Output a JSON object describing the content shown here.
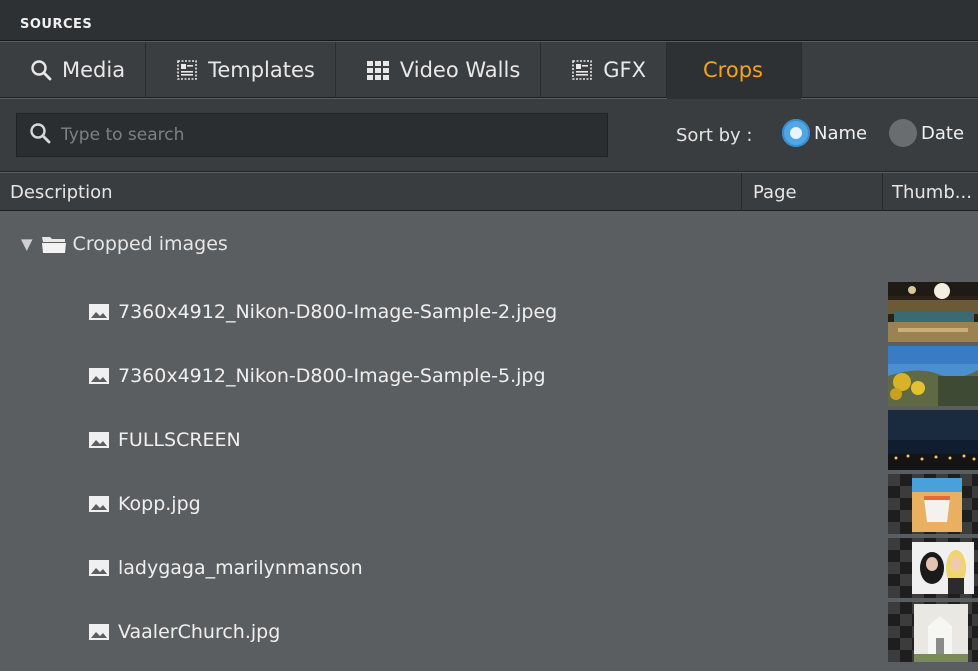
{
  "panel": {
    "title": "SOURCES"
  },
  "tabs": [
    {
      "label": "Media",
      "icon": "search-icon",
      "active": false
    },
    {
      "label": "Templates",
      "icon": "template-icon",
      "active": false
    },
    {
      "label": "Video Walls",
      "icon": "video-wall-icon",
      "active": false
    },
    {
      "label": "GFX",
      "icon": "template-icon",
      "active": false
    },
    {
      "label": "Crops",
      "icon": "",
      "active": true
    }
  ],
  "search": {
    "placeholder": "Type to search",
    "value": ""
  },
  "sort": {
    "label": "Sort by :",
    "options": [
      {
        "label": "Name",
        "selected": true
      },
      {
        "label": "Date",
        "selected": false
      }
    ]
  },
  "columns": {
    "description": "Description",
    "page": "Page",
    "thumbnail": "Thumb..."
  },
  "tree": {
    "folder": {
      "label": "Cropped images",
      "expanded": true,
      "icon": "folder-open-icon"
    },
    "items": [
      {
        "label": "7360x4912_Nikon-D800-Image-Sample-2.jpeg",
        "icon": "image-icon",
        "thumb": "hall"
      },
      {
        "label": "7360x4912_Nikon-D800-Image-Sample-5.jpg",
        "icon": "image-icon",
        "thumb": "landscape"
      },
      {
        "label": "FULLSCREEN",
        "icon": "image-icon",
        "thumb": "night"
      },
      {
        "label": "Kopp.jpg",
        "icon": "image-icon",
        "thumb": "cup"
      },
      {
        "label": "ladygaga_marilynmanson",
        "icon": "image-icon",
        "thumb": "portrait"
      },
      {
        "label": "VaalerChurch.jpg",
        "icon": "image-icon",
        "thumb": "church"
      }
    ]
  },
  "colors": {
    "accent": "#f6a21c",
    "radio_selected": "#4fa7e6",
    "panel_bg": "#5b5e61"
  }
}
